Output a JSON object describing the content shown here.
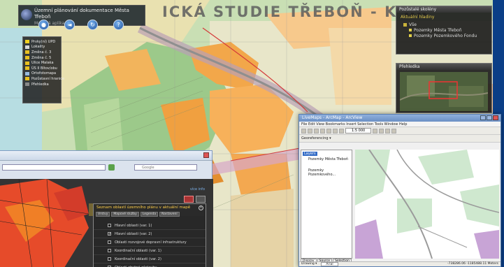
{
  "map": {
    "title": "ICKÁ STUDIE  TŘEBOŇ - K BR",
    "place_label": "TŘEBOŇ"
  },
  "mini_title": {
    "line1": "Územní plánování dokumentace Města Třeboň",
    "line2": "Mapová aplikace"
  },
  "legend": {
    "items": [
      {
        "label": "Prvky(ní) UPD",
        "color": "#f2d020"
      },
      {
        "label": "Lokality",
        "color": "#d9d9d9"
      },
      {
        "label": "Změna č. 3",
        "color": "#e8c020"
      },
      {
        "label": "Změna č. 5",
        "color": "#e8c020"
      },
      {
        "label": "Ulice Malaka",
        "color": "#e8c020"
      },
      {
        "label": "ÚS II Bítov/obu",
        "color": "#e8c020"
      },
      {
        "label": "Ortofotomapa",
        "color": "#9bd"
      },
      {
        "label": "Pozůstavní hranice",
        "color": "#e8c020"
      },
      {
        "label": "Přehledka",
        "color": "#888"
      }
    ]
  },
  "panel_right": {
    "title": "Pozůstalé skolény",
    "subtitle": "Aktuální hladiny",
    "items": [
      "Vše",
      "Pozemky Města Třeboň",
      "Pozemky Pozemkového Fondu"
    ]
  },
  "overview": {
    "title": "Přehledka"
  },
  "arcmap": {
    "title": "LiveMaps - ArcMap - ArcView",
    "menu": "File  Edit  View  Bookmarks  Insert  Selection  Tools  Window  Help",
    "scale": "1:5 000",
    "georef": "Georeferencing ▾",
    "toc_layers": "Layers",
    "toc_items": [
      "Pozemky Města Třeboň",
      "Pozemky Pozemkového..."
    ],
    "tabs": [
      "Display",
      "Source",
      "Selection"
    ],
    "drawing": "Drawing ▾",
    "font": "Arial",
    "status": "-738286.06  -1185488.11 Meters"
  },
  "browser": {
    "search_placeholder": "Google",
    "dialog_title": "Seznam oblastí územního plánu v aktuální mapě",
    "tabs": [
      "Vrstvy",
      "Mapové služby",
      "Legenda",
      "Nastavení"
    ],
    "layers": [
      {
        "label": "Hlavní oblasti (var. 1)",
        "checked": false
      },
      {
        "label": "Hlavní oblasti (var. 2)",
        "checked": true
      },
      {
        "label": "Oblasti rozvojové dopravní infrastruktury",
        "checked": false
      },
      {
        "label": "Koordinační oblasti (var. 1)",
        "checked": false
      },
      {
        "label": "Koordinační oblasti (var. 2)",
        "checked": false
      },
      {
        "label": "Oblasti obytné zástavby",
        "checked": false
      }
    ],
    "link": "více info"
  }
}
